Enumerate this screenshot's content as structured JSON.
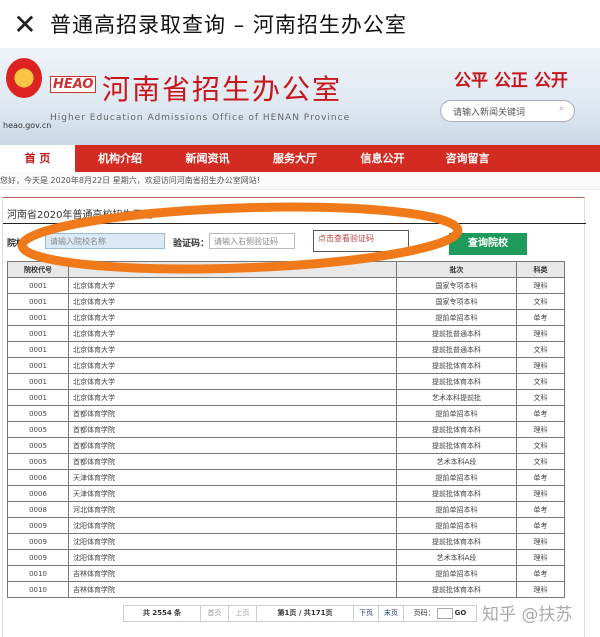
{
  "topbar": {
    "close_icon": "close-icon",
    "title": "普通高招录取查询 – 河南招生办公室"
  },
  "banner": {
    "abbr": "HEAO",
    "site_name": "河南省招生办公室",
    "subtitle": "Higher Education Admissions Office of HENAN Province",
    "domain": "heao.gov.cn",
    "slogan": "公平 公正 公开",
    "search_placeholder": "请输入新闻关键词"
  },
  "nav": [
    "首 页",
    "机构介绍",
    "新闻资讯",
    "服务大厅",
    "信息公开",
    "咨询留言"
  ],
  "welcome": "您好，今天是 2020年8月22日 星期六，欢迎访问河南省招生办公室网站!",
  "panel": {
    "title": "河南省2020年普通高校招生已经",
    "school_label": "院校",
    "school_placeholder": "请输入院校名称",
    "captcha_label": "验证码：",
    "captcha_placeholder": "请输入右侧验证码",
    "captcha_image_text": "点击查看验证码",
    "query_button": "查询院校"
  },
  "table": {
    "headers": [
      "院校代号",
      "",
      "批次",
      "科类"
    ],
    "rows": [
      [
        "0001",
        "北京体育大学",
        "国家专项本科",
        "理科"
      ],
      [
        "0001",
        "北京体育大学",
        "国家专项本科",
        "文科"
      ],
      [
        "0001",
        "北京体育大学",
        "提前单招本科",
        "单考"
      ],
      [
        "0001",
        "北京体育大学",
        "提前批普通本科",
        "理科"
      ],
      [
        "0001",
        "北京体育大学",
        "提前批普通本科",
        "文科"
      ],
      [
        "0001",
        "北京体育大学",
        "提前批体育本科",
        "理科"
      ],
      [
        "0001",
        "北京体育大学",
        "提前批体育本科",
        "文科"
      ],
      [
        "0001",
        "北京体育大学",
        "艺术本科提前批",
        "文科"
      ],
      [
        "0005",
        "首都体育学院",
        "提前单招本科",
        "单考"
      ],
      [
        "0005",
        "首都体育学院",
        "提前批体育本科",
        "理科"
      ],
      [
        "0005",
        "首都体育学院",
        "提前批体育本科",
        "文科"
      ],
      [
        "0005",
        "首都体育学院",
        "艺术本科A段",
        "文科"
      ],
      [
        "0006",
        "天津体育学院",
        "提前单招本科",
        "单考"
      ],
      [
        "0006",
        "天津体育学院",
        "提前批体育本科",
        "理科"
      ],
      [
        "0008",
        "河北体育学院",
        "提前单招本科",
        "单考"
      ],
      [
        "0009",
        "沈阳体育学院",
        "提前单招本科",
        "单考"
      ],
      [
        "0009",
        "沈阳体育学院",
        "提前批体育本科",
        "理科"
      ],
      [
        "0009",
        "沈阳体育学院",
        "艺术本科A段",
        "理科"
      ],
      [
        "0010",
        "吉林体育学院",
        "提前单招本科",
        "单考"
      ],
      [
        "0010",
        "吉林体育学院",
        "提前批体育本科",
        "理科"
      ]
    ]
  },
  "pager": {
    "total": "共 2554 条",
    "first": "首页",
    "prev": "上页",
    "page": "第1页 / 共171页",
    "next": "下页",
    "last": "末页",
    "goto_label": "页码：",
    "go": "GO"
  },
  "watermark": "知乎 @扶苏",
  "colors": {
    "nav_red": "#d32a22",
    "button_green": "#1e9a5a",
    "annotation_orange": "#f07a1a"
  }
}
